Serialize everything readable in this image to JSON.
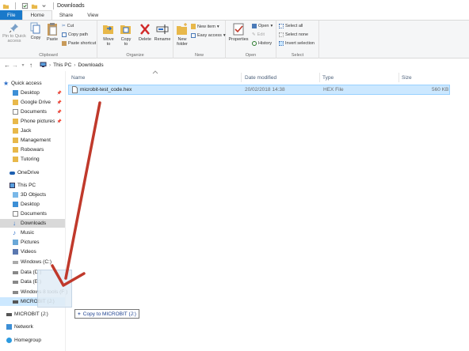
{
  "window": {
    "title": "Downloads"
  },
  "tabs": [
    {
      "label": "File"
    },
    {
      "label": "Home"
    },
    {
      "label": "Share"
    },
    {
      "label": "View"
    }
  ],
  "ribbon": {
    "clipboard": {
      "pin": "Pin to Quick\naccess",
      "copy": "Copy",
      "paste": "Paste",
      "cut": "Cut",
      "copy_path": "Copy path",
      "paste_shortcut": "Paste shortcut",
      "label": "Clipboard"
    },
    "organize": {
      "move_to": "Move\nto",
      "copy_to": "Copy\nto",
      "delete": "Delete",
      "rename": "Rename",
      "label": "Organize"
    },
    "new": {
      "new_folder": "New\nfolder",
      "new_item": "New item",
      "easy_access": "Easy access",
      "label": "New"
    },
    "open": {
      "properties": "Properties",
      "open": "Open",
      "edit": "Edit",
      "history": "History",
      "label": "Open"
    },
    "select": {
      "select_all": "Select all",
      "select_none": "Select none",
      "invert": "Invert selection",
      "label": "Select"
    }
  },
  "address": {
    "crumb1": "This PC",
    "crumb2": "Downloads"
  },
  "nav": {
    "quick_access": "Quick access",
    "desktop": "Desktop",
    "google_drive": "Google Drive",
    "documents": "Documents",
    "phone_pictures": "Phone pictures",
    "jack": "Jack",
    "management": "Management",
    "robowars": "Robowars",
    "tutoring": "Tutoring",
    "onedrive": "OneDrive",
    "this_pc": "This PC",
    "objects3d": "3D Objects",
    "pc_desktop": "Desktop",
    "pc_documents": "Documents",
    "downloads": "Downloads",
    "music": "Music",
    "pictures": "Pictures",
    "videos": "Videos",
    "windows_c": "Windows (C:)",
    "data_d": "Data (D:)",
    "data_e": "Data (E:)",
    "windows_f": "Windows 8 tools (F:)",
    "microbit_1": "MICROBIT (J:)",
    "microbit_2": "MICROBIT (J:)",
    "network": "Network",
    "homegroup": "Homegroup"
  },
  "columns": {
    "name": "Name",
    "date": "Date modified",
    "type": "Type",
    "size": "Size"
  },
  "files": [
    {
      "name": "microbit-test_code.hex",
      "date": "20/02/2018 14:38",
      "type": "HEX File",
      "size": "560 KB"
    }
  ],
  "drag_tooltip": {
    "text": "Copy to MICROBIT (J:)"
  },
  "colors": {
    "accent": "#1979ca",
    "selection": "#cce8ff",
    "annotation_arrow": "#c0392b"
  }
}
